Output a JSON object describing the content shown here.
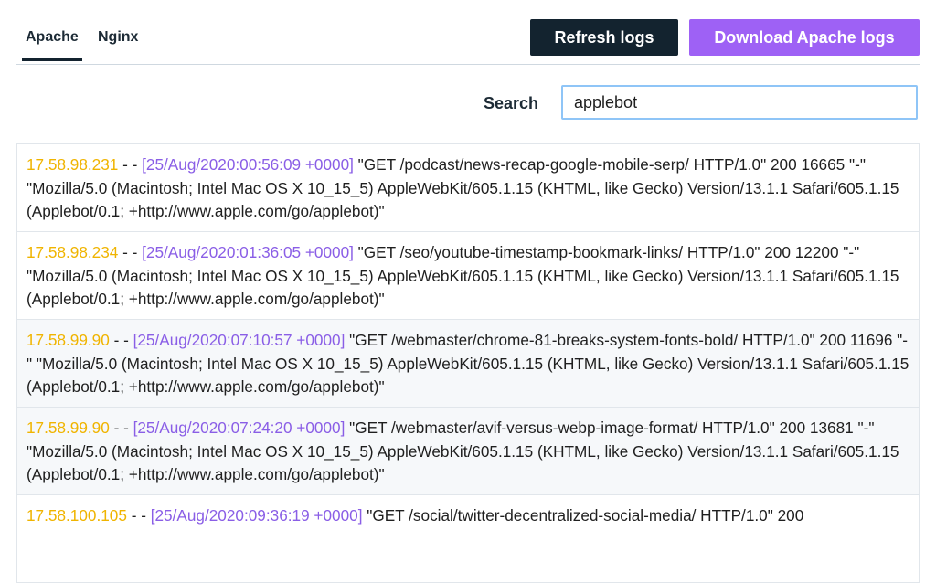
{
  "tabs": [
    {
      "label": "Apache",
      "active": true
    },
    {
      "label": "Nginx",
      "active": false
    }
  ],
  "toolbar": {
    "refresh_label": "Refresh logs",
    "download_label": "Download Apache logs"
  },
  "search": {
    "label": "Search",
    "value": "applebot"
  },
  "colors": {
    "ip": "#f0b400",
    "timestamp": "#8a5ee6",
    "primary_button": "#13232f",
    "accent_button": "#9e61f5"
  },
  "logs": [
    {
      "ip": "17.58.98.231",
      "sep": " - - ",
      "timestamp": "[25/Aug/2020:00:56:09 +0000]",
      "request": " \"GET /podcast/news-recap-google-mobile-serp/ HTTP/1.0\" 200 16665 \"-\" \"Mozilla/5.0 (Macintosh; Intel Mac OS X 10_15_5) AppleWebKit/605.1.15 (KHTML, like Gecko) Version/13.1.1 Safari/605.1.15 (Applebot/0.1; +http://www.apple.com/go/applebot)\""
    },
    {
      "ip": "17.58.98.234",
      "sep": " - - ",
      "timestamp": "[25/Aug/2020:01:36:05 +0000]",
      "request": " \"GET /seo/youtube-timestamp-bookmark-links/ HTTP/1.0\" 200 12200 \"-\" \"Mozilla/5.0 (Macintosh; Intel Mac OS X 10_15_5) AppleWebKit/605.1.15 (KHTML, like Gecko) Version/13.1.1 Safari/605.1.15 (Applebot/0.1; +http://www.apple.com/go/applebot)\""
    },
    {
      "ip": "17.58.99.90",
      "sep": " - - ",
      "timestamp": "[25/Aug/2020:07:10:57 +0000]",
      "request": " \"GET /webmaster/chrome-81-breaks-system-fonts-bold/ HTTP/1.0\" 200 11696 \"-\" \"Mozilla/5.0 (Macintosh; Intel Mac OS X 10_15_5) AppleWebKit/605.1.15 (KHTML, like Gecko) Version/13.1.1 Safari/605.1.15 (Applebot/0.1; +http://www.apple.com/go/applebot)\""
    },
    {
      "ip": "17.58.99.90",
      "sep": " - - ",
      "timestamp": "[25/Aug/2020:07:24:20 +0000]",
      "request": " \"GET /webmaster/avif-versus-webp-image-format/ HTTP/1.0\" 200 13681 \"-\" \"Mozilla/5.0 (Macintosh; Intel Mac OS X 10_15_5) AppleWebKit/605.1.15 (KHTML, like Gecko) Version/13.1.1 Safari/605.1.15 (Applebot/0.1; +http://www.apple.com/go/applebot)\""
    },
    {
      "ip": "17.58.100.105",
      "sep": " - - ",
      "timestamp": "[25/Aug/2020:09:36:19 +0000]",
      "request": " \"GET /social/twitter-decentralized-social-media/ HTTP/1.0\" 200"
    }
  ]
}
